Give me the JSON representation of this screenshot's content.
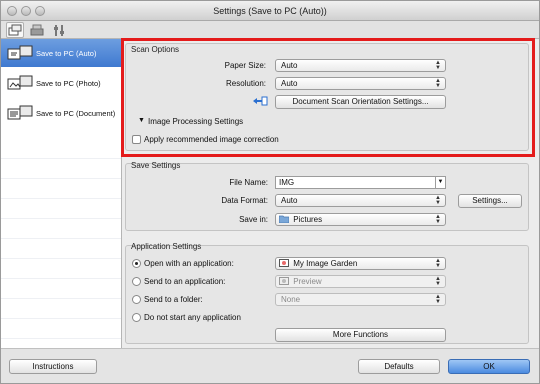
{
  "window": {
    "title": "Settings (Save to PC (Auto))"
  },
  "toolbar": {
    "icons": [
      "scan-from-pc-icon",
      "scan-from-panel-icon",
      "general-settings-icon"
    ]
  },
  "sidebar": {
    "items": [
      {
        "label": "Save to PC (Auto)",
        "selected": true
      },
      {
        "label": "Save to PC (Photo)",
        "selected": false
      },
      {
        "label": "Save to PC (Document)",
        "selected": false
      }
    ]
  },
  "scan_options": {
    "title": "Scan Options",
    "paper_size_label": "Paper Size:",
    "paper_size_value": "Auto",
    "resolution_label": "Resolution:",
    "resolution_value": "Auto",
    "orientation_button": "Document Scan Orientation Settings...",
    "image_processing_label": "Image Processing Settings",
    "apply_correction_label": "Apply recommended image correction",
    "apply_correction_checked": false
  },
  "save_settings": {
    "title": "Save Settings",
    "file_name_label": "File Name:",
    "file_name_value": "IMG",
    "data_format_label": "Data Format:",
    "data_format_value": "Auto",
    "settings_button": "Settings...",
    "save_in_label": "Save in:",
    "save_in_value": "Pictures"
  },
  "application_settings": {
    "title": "Application Settings",
    "options": [
      {
        "label": "Open with an application:",
        "value": "My Image Garden",
        "selected": true,
        "disabled": false
      },
      {
        "label": "Send to an application:",
        "value": "Preview",
        "selected": false,
        "disabled": true
      },
      {
        "label": "Send to a folder:",
        "value": "None",
        "selected": false,
        "disabled": true
      },
      {
        "label": "Do not start any application",
        "selected": false
      }
    ],
    "more_functions_button": "More Functions"
  },
  "bottom_bar": {
    "instructions_button": "Instructions",
    "defaults_button": "Defaults",
    "ok_button": "OK"
  },
  "colors": {
    "highlight": "#e41b1b",
    "selection": "#3f79d0",
    "default_button": "#4b8be0"
  }
}
